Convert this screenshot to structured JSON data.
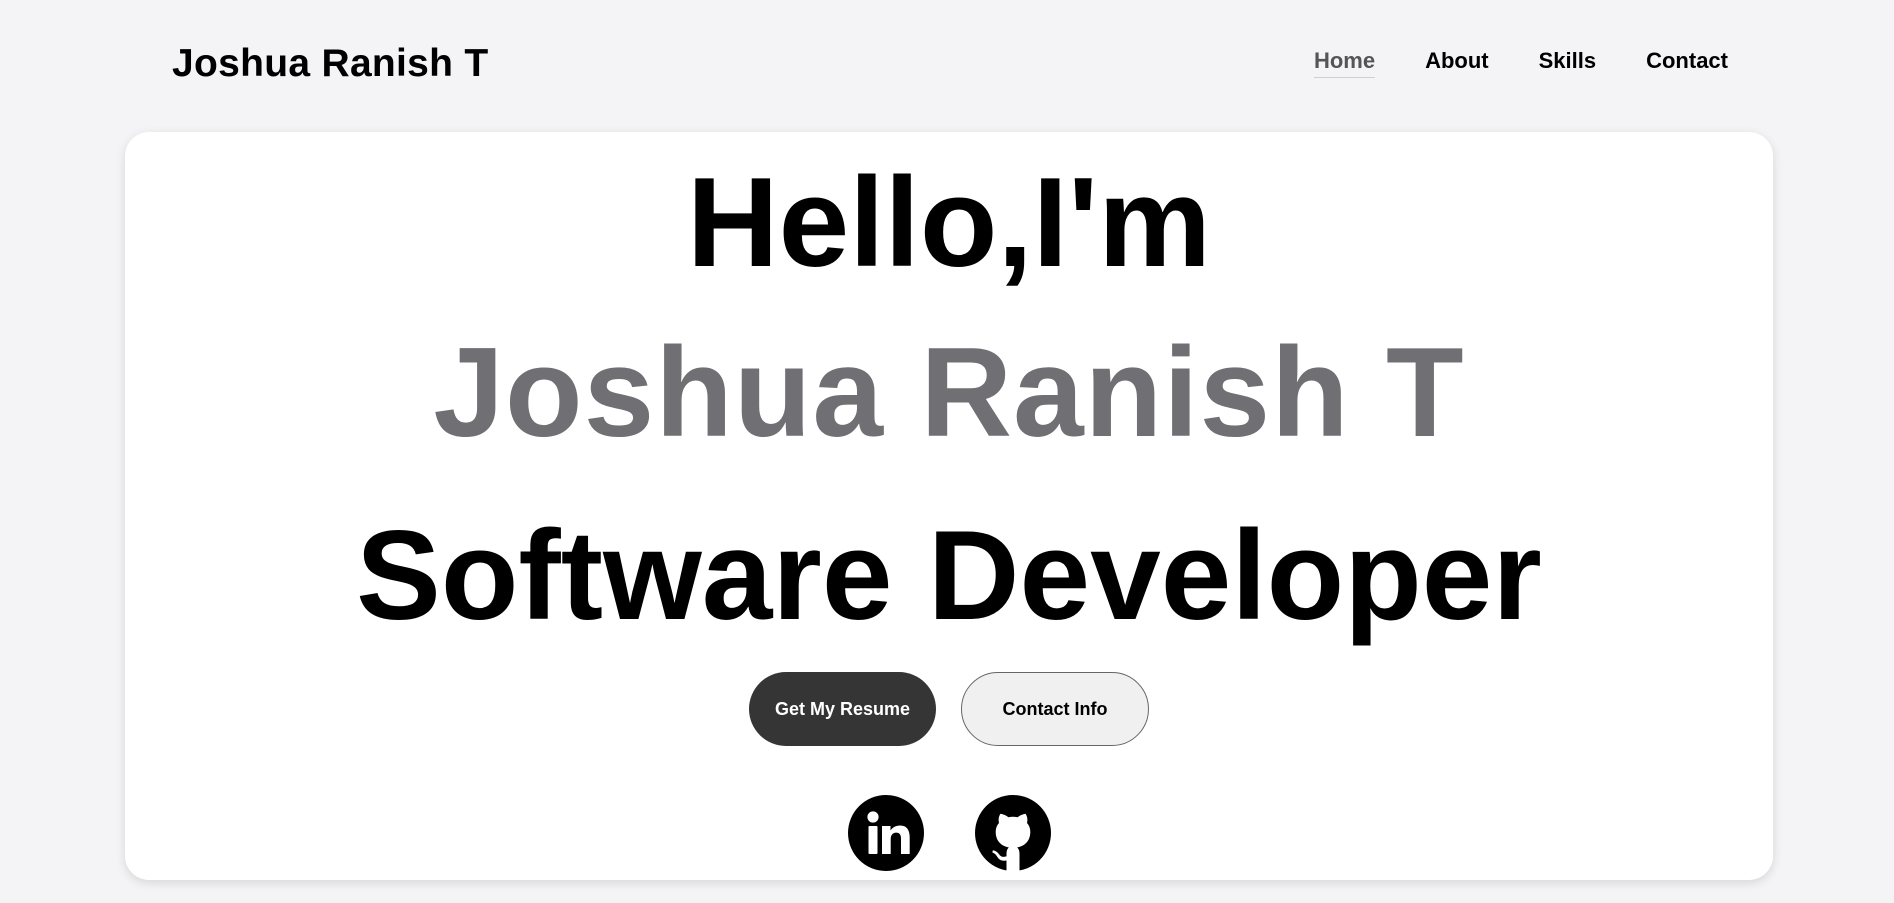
{
  "header": {
    "brand": "Joshua Ranish T",
    "nav": [
      {
        "label": "Home",
        "active": true
      },
      {
        "label": "About",
        "active": false
      },
      {
        "label": "Skills",
        "active": false
      },
      {
        "label": "Contact",
        "active": false
      }
    ]
  },
  "hero": {
    "greeting": "Hello,I'm",
    "name": "Joshua Ranish T",
    "role": "Software Developer",
    "buttons": {
      "primary": "Get My Resume",
      "secondary": "Contact Info"
    },
    "socials": [
      {
        "icon": "linkedin-icon"
      },
      {
        "icon": "github-icon"
      }
    ]
  },
  "colors": {
    "background": "#f4f4f6",
    "card": "#ffffff",
    "name_gray": "#707074",
    "primary_button": "#353535",
    "text": "#000000"
  }
}
